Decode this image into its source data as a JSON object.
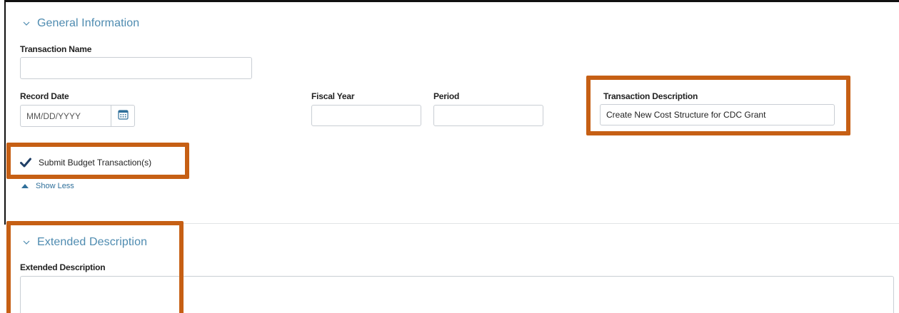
{
  "general": {
    "header": "General Information",
    "transaction_name": {
      "label": "Transaction Name",
      "value": ""
    },
    "record_date": {
      "label": "Record Date",
      "placeholder": "MM/DD/YYYY"
    },
    "fiscal_year": {
      "label": "Fiscal Year",
      "value": ""
    },
    "period": {
      "label": "Period",
      "value": ""
    },
    "transaction_description": {
      "label": "Transaction Description",
      "value": "Create New Cost Structure for CDC Grant"
    },
    "submit_budget": {
      "label": "Submit Budget Transaction(s)",
      "checked": true
    },
    "show_less": "Show Less"
  },
  "extended": {
    "header": "Extended Description",
    "field_label": "Extended Description",
    "value": ""
  },
  "colors": {
    "accent": "#4e8bb0",
    "link": "#2f6f9a",
    "highlight": "#c65f14",
    "checkbox": "#1f3f66"
  },
  "icons": {
    "section_toggle": "chevron-down-icon",
    "calendar": "calendar-icon",
    "checkbox": "checkmark-icon",
    "show_less": "triangle-up-icon"
  }
}
